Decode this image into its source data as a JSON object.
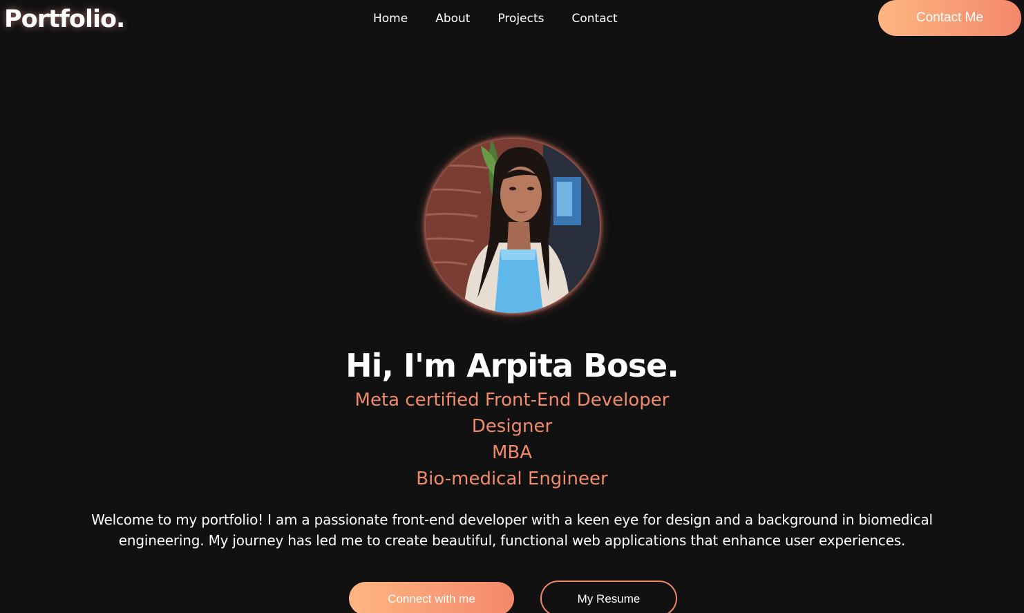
{
  "header": {
    "logo": "Portfolio.",
    "nav": [
      {
        "label": "Home"
      },
      {
        "label": "About"
      },
      {
        "label": "Projects"
      },
      {
        "label": "Contact"
      }
    ],
    "cta_label": "Contact Me"
  },
  "hero": {
    "avatar_icon": "profile-photo",
    "title": "Hi, I'm Arpita Bose.",
    "roles": [
      "Meta certified Front-End Developer",
      "Designer",
      "MBA",
      "Bio-medical Engineer"
    ],
    "intro": "Welcome to my portfolio! I am a passionate front-end developer with a keen eye for design and a background in biomedical engineering. My journey has led me to create beautiful, functional web applications that enhance user experiences.",
    "primary_button": "Connect with me",
    "secondary_button": "My Resume"
  },
  "colors": {
    "background": "#111111",
    "accent_start": "#feb582",
    "accent_end": "#f3886b",
    "role_text": "#ef8a6a"
  }
}
